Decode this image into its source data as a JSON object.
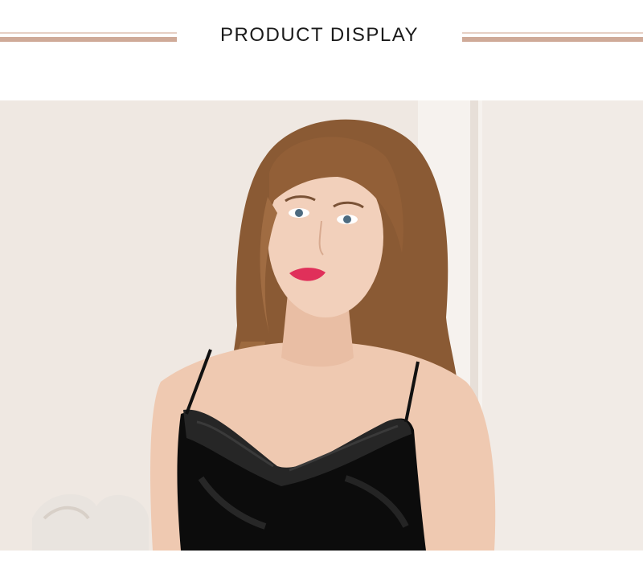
{
  "header": {
    "title": "PRODUCT DISPLAY",
    "rule_thin_color": "#e6cfc4",
    "rule_thick_color": "#cfaa98"
  },
  "photo": {
    "subject": "product-photo"
  }
}
